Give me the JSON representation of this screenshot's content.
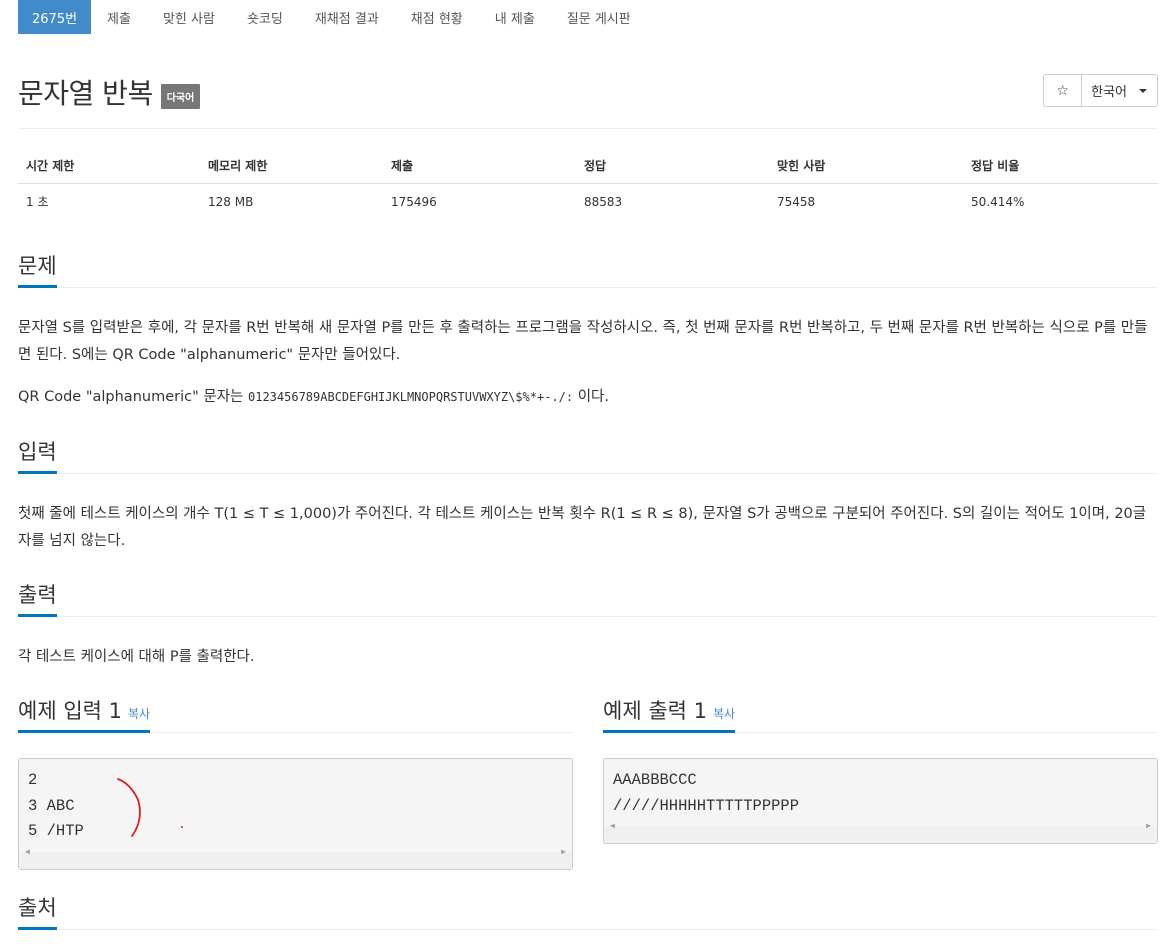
{
  "nav": {
    "items": [
      {
        "label": "2675번",
        "active": true
      },
      {
        "label": "제출"
      },
      {
        "label": "맞힌 사람"
      },
      {
        "label": "숏코딩"
      },
      {
        "label": "재채점 결과"
      },
      {
        "label": "채점 현황"
      },
      {
        "label": "내 제출"
      },
      {
        "label": "질문 게시판"
      }
    ]
  },
  "problem": {
    "title": "문자열 반복",
    "badge": "다국어",
    "star_icon": "☆",
    "language": "한국어"
  },
  "stats": {
    "headers": [
      "시간 제한",
      "메모리 제한",
      "제출",
      "정답",
      "맞힌 사람",
      "정답 비율"
    ],
    "values": [
      "1 초",
      "128 MB",
      "175496",
      "88583",
      "75458",
      "50.414%"
    ]
  },
  "sections": {
    "problem_heading": "문제",
    "problem_text_1": "문자열 S를 입력받은 후에, 각 문자를 R번 반복해 새 문자열 P를 만든 후 출력하는 프로그램을 작성하시오. 즉, 첫 번째 문자를 R번 반복하고, 두 번째 문자를 R번 반복하는 식으로 P를 만들면 된다. S에는 QR Code \"alphanumeric\" 문자만 들어있다.",
    "problem_text_2_prefix": "QR Code \"alphanumeric\" 문자는 ",
    "problem_text_2_code": "0123456789ABCDEFGHIJKLMNOPQRSTUVWXYZ\\$%*+-./:",
    "problem_text_2_suffix": " 이다.",
    "input_heading": "입력",
    "input_text": "첫째 줄에 테스트 케이스의 개수 T(1 ≤ T ≤ 1,000)가 주어진다. 각 테스트 케이스는 반복 횟수 R(1 ≤ R ≤ 8), 문자열 S가 공백으로 구분되어 주어진다. S의 길이는 적어도 1이며, 20글자를 넘지 않는다.",
    "output_heading": "출력",
    "output_text": "각 테스트 케이스에 대해 P를 출력한다.",
    "source_heading": "출처"
  },
  "samples": {
    "input_heading": "예제 입력 1",
    "output_heading": "예제 출력 1",
    "copy_label": "복사",
    "input_lines": [
      "2",
      "3 ABC",
      "5 /HTP"
    ],
    "output_lines": [
      "AAABBBCCC",
      "/////HHHHHTTTTTPPPPP"
    ],
    "annotation_color": "#e02020"
  }
}
